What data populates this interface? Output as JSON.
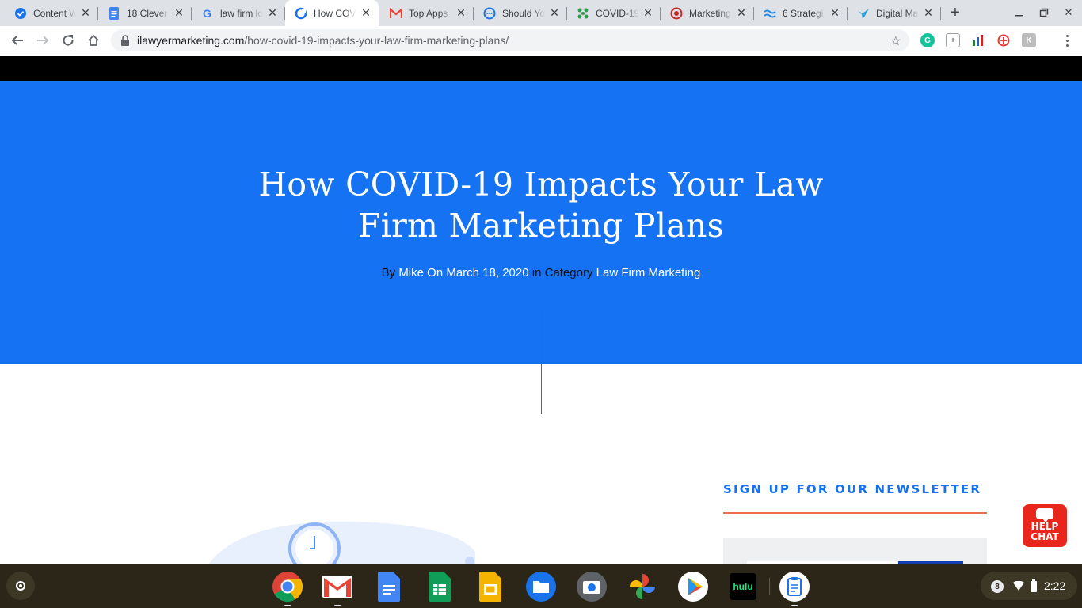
{
  "browser": {
    "tabs": [
      {
        "title": "Content W",
        "icon": "check-circle-icon",
        "color": "#1a73e8"
      },
      {
        "title": "18 Clever",
        "icon": "docs-icon",
        "color": "#4285f4"
      },
      {
        "title": "law firm lo",
        "icon": "google-icon",
        "color": "#4285f4"
      },
      {
        "title": "How COV",
        "icon": "site-icon",
        "color": "#1472f3",
        "active": true
      },
      {
        "title": "Top Apps",
        "icon": "gmail-icon",
        "color": "#ea4335"
      },
      {
        "title": "Should Yo",
        "icon": "chat-icon",
        "color": "#1a73e8"
      },
      {
        "title": "COVID-19",
        "icon": "covid-icon",
        "color": "#2e9b4d"
      },
      {
        "title": "Marketing",
        "icon": "record-icon",
        "color": "#c62828"
      },
      {
        "title": "6 Strategi",
        "icon": "wave-icon",
        "color": "#1e88e5"
      },
      {
        "title": "Digital Ma",
        "icon": "bird-icon",
        "color": "#29a3d8"
      }
    ],
    "url_host": "ilawyermarketing.com",
    "url_path": "/how-covid-19-impacts-your-law-firm-marketing-plans/"
  },
  "page": {
    "title_line1": "How COVID-19 Impacts Your Law",
    "title_line2": "Firm Marketing Plans",
    "meta": {
      "by": "By",
      "author": "Mike",
      "on": "On",
      "date": "March 18, 2020",
      "in": "in",
      "category_label": "Category",
      "category": "Law Firm Marketing"
    },
    "newsletter_title": "SIGN UP FOR OUR NEWSLETTER",
    "helpchat_line1": "HELP",
    "helpchat_line2": "CHAT"
  },
  "shelf": {
    "apps": [
      "chrome-icon",
      "gmail-icon",
      "docs-icon",
      "sheets-icon",
      "slides-icon",
      "files-icon",
      "camera-icon",
      "photos-icon",
      "play-store-icon",
      "hulu-icon",
      "clipboard-icon"
    ],
    "hulu_label": "hulu",
    "notification_count": "8",
    "time": "2:22"
  },
  "colors": {
    "hero": "#1472f3",
    "accent_rule": "#ed6e50",
    "helpchat": "#e8261c"
  }
}
